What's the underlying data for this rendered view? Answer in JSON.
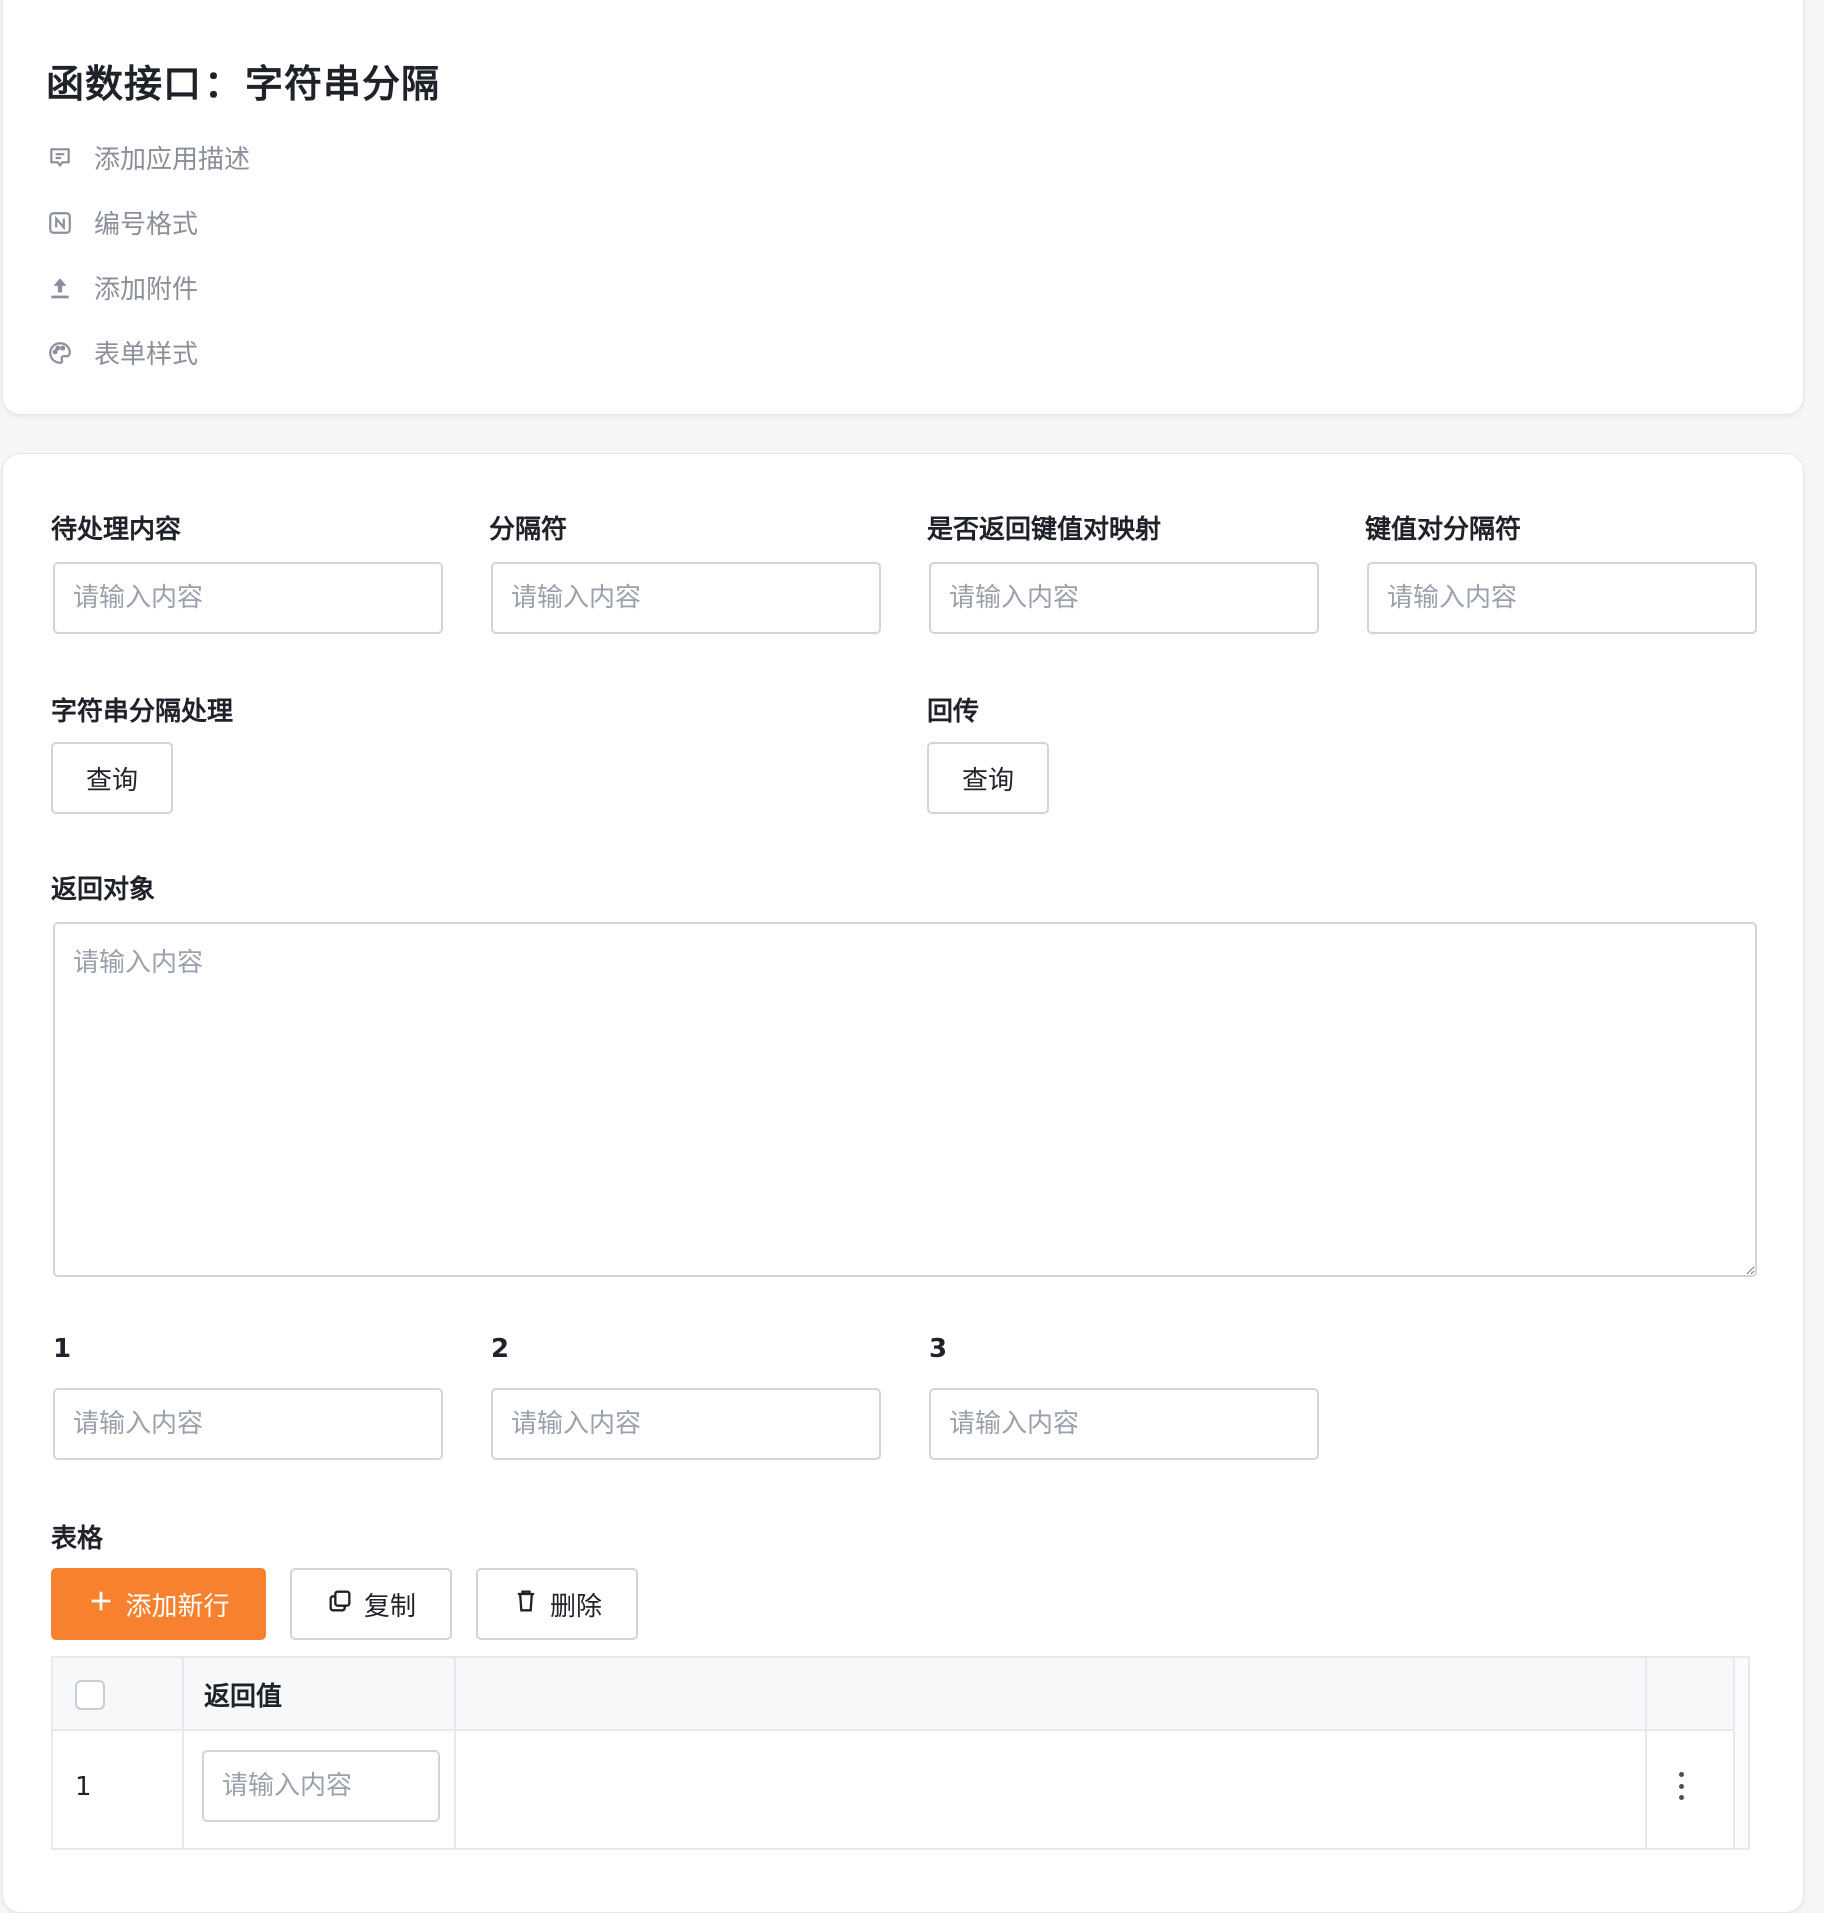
{
  "header": {
    "title_prefix": "函数接口",
    "title_sep": "：",
    "title_name": "字符串分隔",
    "meta_items": [
      {
        "label": "添加应用描述",
        "icon": "comment-icon"
      },
      {
        "label": "编号格式",
        "icon": "number-format-icon"
      },
      {
        "label": "添加附件",
        "icon": "upload-icon"
      },
      {
        "label": "表单样式",
        "icon": "palette-icon"
      }
    ]
  },
  "form": {
    "placeholder": "请输入内容",
    "row1": [
      {
        "label": "待处理内容",
        "value": ""
      },
      {
        "label": "分隔符",
        "value": ""
      },
      {
        "label": "是否返回键值对映射",
        "value": ""
      },
      {
        "label": "键值对分隔符",
        "value": ""
      }
    ],
    "actions": [
      {
        "label": "字符串分隔处理",
        "button": "查询"
      },
      {
        "label": "回传",
        "button": "查询"
      }
    ],
    "return_object": {
      "label": "返回对象",
      "value": ""
    },
    "row3": [
      {
        "label": "1",
        "value": ""
      },
      {
        "label": "2",
        "value": ""
      },
      {
        "label": "3",
        "value": ""
      }
    ],
    "table": {
      "label": "表格",
      "toolbar": {
        "add": "添加新行",
        "copy": "复制",
        "delete": "删除"
      },
      "columns": [
        "返回值"
      ],
      "rows": [
        {
          "index": "1",
          "value": ""
        }
      ]
    }
  },
  "colors": {
    "primary": "#f7812e",
    "border": "#d0d5dd",
    "placeholder": "#9aa1ac"
  }
}
